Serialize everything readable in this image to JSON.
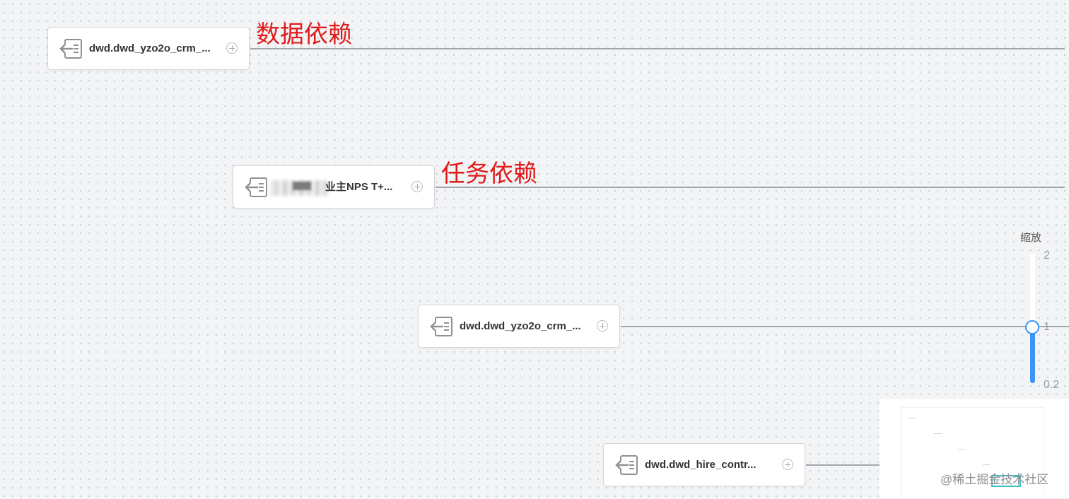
{
  "nodes": [
    {
      "label": "dwd.dwd_yzo2o_crm_...",
      "icon": "table-import-icon"
    },
    {
      "label": "业主NPS T+...",
      "icon": "table-import-icon",
      "obscured_prefix": true
    },
    {
      "label": "dwd.dwd_yzo2o_crm_...",
      "icon": "table-import-icon"
    },
    {
      "label": "dwd.dwd_hire_contr...",
      "icon": "table-import-icon"
    }
  ],
  "annotations": {
    "data_dependency": "数据依赖",
    "task_dependency": "任务依赖"
  },
  "zoom": {
    "title": "缩放",
    "max_label": "2",
    "mid_label": "1",
    "min_label": "0.2",
    "value": 1,
    "range": [
      0.2,
      2
    ],
    "accent_color": "#3e96f4"
  },
  "watermark": "@稀土掘金技术社区",
  "colors": {
    "annotation": "#e01b1b",
    "edge": "#a3a6ab",
    "minimap_viewport": "#3cc2c2"
  }
}
